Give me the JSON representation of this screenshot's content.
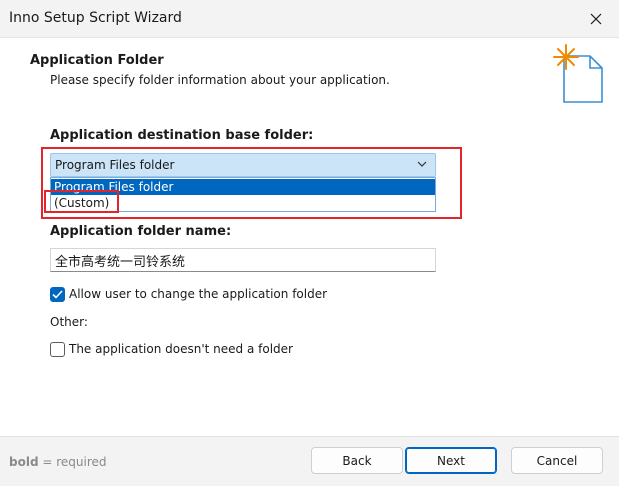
{
  "window": {
    "title": "Inno Setup Script Wizard",
    "close_icon": "close-icon"
  },
  "header": {
    "title": "Application Folder",
    "subtitle": "Please specify folder information about your application.",
    "icon": "wizard-sparkle-document-icon",
    "accent_color": "#f08a00"
  },
  "form": {
    "base_folder": {
      "label": "Application destination base folder:",
      "selected_value": "Program Files folder",
      "options": [
        "Program Files folder",
        "(Custom)"
      ],
      "highlighted_option": "Program Files folder"
    },
    "folder_name": {
      "label": "Application folder name:",
      "value": "全市高考统一司铃系统"
    },
    "allow_change": {
      "label": "Allow user to change the application folder",
      "checked": true
    },
    "other_label": "Other:",
    "no_folder": {
      "label": "The application doesn't need a folder",
      "checked": false
    }
  },
  "footer": {
    "note_bold": "bold",
    "note_rest": " = required",
    "back_label": "Back",
    "next_label": "Next",
    "cancel_label": "Cancel"
  },
  "colors": {
    "accent": "#0067c0",
    "annotation_red": "#e2252b"
  }
}
